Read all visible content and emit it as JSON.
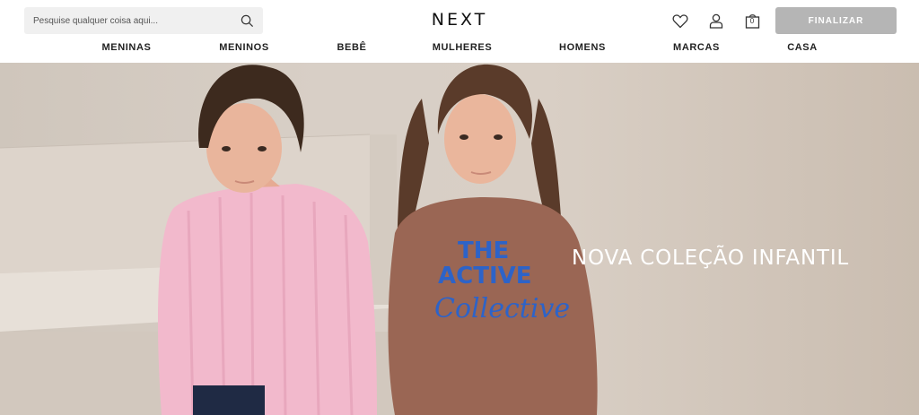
{
  "header": {
    "search": {
      "placeholder": "Pesquise qualquer coisa aqui..."
    },
    "logo": "NEXT",
    "checkout_label": "FINALIZAR",
    "icons": [
      "search-icon",
      "heart-icon",
      "user-icon",
      "bag-icon"
    ],
    "bag_count": "0"
  },
  "nav": {
    "items": [
      {
        "label": "MENINAS"
      },
      {
        "label": "MENINOS"
      },
      {
        "label": "BEBÊ"
      },
      {
        "label": "MULHERES"
      },
      {
        "label": "HOMENS"
      },
      {
        "label": "MARCAS"
      },
      {
        "label": "CASA"
      }
    ]
  },
  "hero": {
    "title": "NOVA COLEÇÃO INFANTIL",
    "sweatshirt_text": [
      "THE",
      "ACTIVE",
      "Collective"
    ]
  },
  "colors": {
    "checkout_button": "#b5b5b5",
    "hero_background": "#d6cdc3",
    "pink_sweater": "#f2b9cc",
    "brown_sweatshirt": "#9a6654",
    "print_blue": "#2d63c8"
  }
}
